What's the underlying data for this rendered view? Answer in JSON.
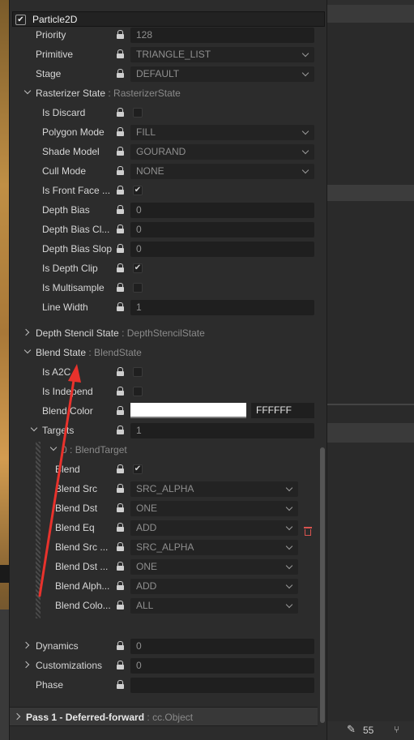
{
  "header": {
    "title": "Particle2D",
    "checked": "✔"
  },
  "props": {
    "priority": {
      "label": "Priority",
      "value": "128"
    },
    "primitive": {
      "label": "Primitive",
      "value": "TRIANGLE_LIST"
    },
    "stage": {
      "label": "Stage",
      "value": "DEFAULT"
    }
  },
  "rasterizer": {
    "label": "Rasterizer State",
    "type": ": RasterizerState",
    "is_discard": "Is Discard",
    "polygon_mode": {
      "label": "Polygon Mode",
      "value": "FILL"
    },
    "shade_model": {
      "label": "Shade Model",
      "value": "GOURAND"
    },
    "cull_mode": {
      "label": "Cull Mode",
      "value": "NONE"
    },
    "is_front_face": {
      "label": "Is Front Face ...",
      "checked": "✔"
    },
    "depth_bias": {
      "label": "Depth Bias",
      "value": "0"
    },
    "depth_bias_clamp": {
      "label": "Depth Bias Cl...",
      "value": "0"
    },
    "depth_bias_slop": {
      "label": "Depth Bias Slop",
      "value": "0"
    },
    "is_depth_clip": {
      "label": "Is Depth Clip",
      "checked": "✔"
    },
    "is_multisample": "Is Multisample",
    "line_width": {
      "label": "Line Width",
      "value": "1"
    }
  },
  "depth_stencil": {
    "label": "Depth Stencil State",
    "type": ": DepthStencilState"
  },
  "blend": {
    "label": "Blend State",
    "type": ": BlendState",
    "is_a2c": "Is A2C",
    "is_independ": "Is Independ",
    "blend_color": {
      "label": "Blend Color",
      "hex": "FFFFFF"
    },
    "targets": {
      "label": "Targets",
      "value": "1"
    },
    "target0": {
      "label": "0",
      "type": ": BlendTarget",
      "blend": {
        "label": "Blend",
        "checked": "✔"
      },
      "blend_src": {
        "label": "Blend Src",
        "value": "SRC_ALPHA"
      },
      "blend_dst": {
        "label": "Blend Dst",
        "value": "ONE"
      },
      "blend_eq": {
        "label": "Blend Eq",
        "value": "ADD"
      },
      "blend_src_alpha": {
        "label": "Blend Src ...",
        "value": "SRC_ALPHA"
      },
      "blend_dst_alpha": {
        "label": "Blend Dst ...",
        "value": "ONE"
      },
      "blend_alpha_eq": {
        "label": "Blend Alph...",
        "value": "ADD"
      },
      "blend_color_mask": {
        "label": "Blend Colo...",
        "value": "ALL"
      }
    }
  },
  "dynamics": {
    "label": "Dynamics",
    "value": "0"
  },
  "customizations": {
    "label": "Customizations",
    "value": "0"
  },
  "phase": {
    "label": "Phase",
    "value": ""
  },
  "pass": {
    "label": "Pass 1 - Deferred-forward",
    "type": ": cc.Object"
  },
  "status": {
    "count": "55"
  },
  "colors": {
    "annotation_arrow": "#e8322c",
    "trash": "#d9534f"
  }
}
